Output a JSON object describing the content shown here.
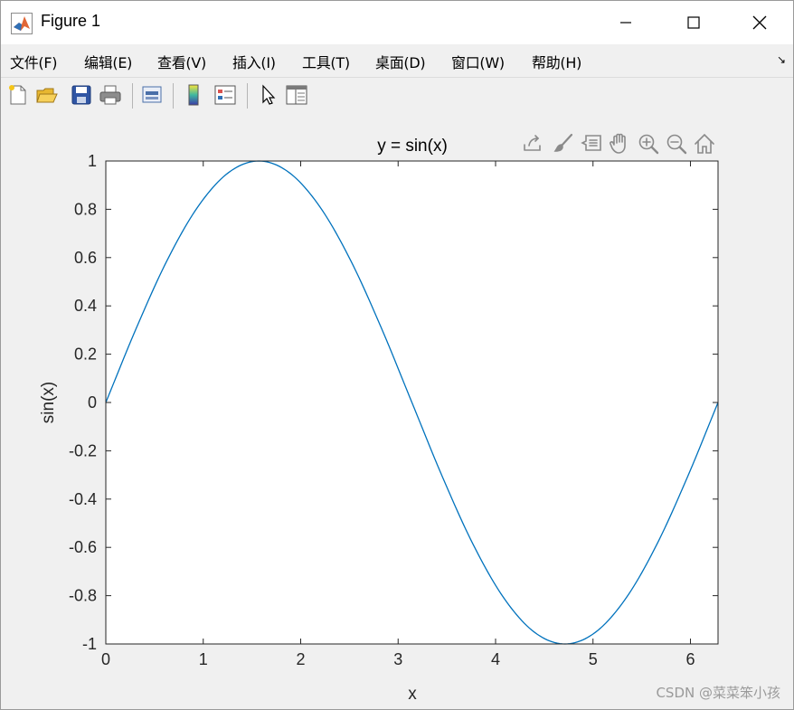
{
  "window": {
    "title": "Figure 1",
    "controls": {
      "minimize": "—",
      "maximize": "☐",
      "close": "✕"
    }
  },
  "menubar": {
    "items": [
      "文件(F)",
      "编辑(E)",
      "查看(V)",
      "插入(I)",
      "工具(T)",
      "桌面(D)",
      "窗口(W)",
      "帮助(H)"
    ],
    "corner": "↘"
  },
  "toolbar": {
    "buttons": [
      "new-figure-icon",
      "open-file-icon",
      "save-icon",
      "print-icon",
      "link-plot-icon",
      "colorbar-icon",
      "legend-icon",
      "edit-plot-pointer-icon",
      "property-inspector-icon"
    ]
  },
  "axes_toolbar": {
    "buttons": [
      "export-icon",
      "brush-icon",
      "data-tips-icon",
      "pan-hand-icon",
      "zoom-in-icon",
      "zoom-out-icon",
      "home-icon"
    ]
  },
  "chart_data": {
    "type": "line",
    "title": "y = sin(x)",
    "xlabel": "x",
    "ylabel": "sin(x)",
    "xlim": [
      0,
      6.2832
    ],
    "ylim": [
      -1,
      1
    ],
    "xticks": [
      0,
      1,
      2,
      3,
      4,
      5,
      6
    ],
    "xtick_labels": [
      "0",
      "1",
      "2",
      "3",
      "4",
      "5",
      "6"
    ],
    "yticks": [
      -1,
      -0.8,
      -0.6,
      -0.4,
      -0.2,
      0,
      0.2,
      0.4,
      0.6,
      0.8,
      1
    ],
    "ytick_labels": [
      "-1",
      "-0.8",
      "-0.6",
      "-0.4",
      "-0.2",
      "0",
      "0.2",
      "0.4",
      "0.6",
      "0.8",
      "1"
    ],
    "grid": false,
    "series": [
      {
        "color": "#0072bd",
        "x": [
          0,
          0.3142,
          0.6283,
          0.9425,
          1.2566,
          1.5708,
          1.885,
          2.1991,
          2.5133,
          2.8274,
          3.1416,
          3.4558,
          3.7699,
          4.0841,
          4.3982,
          4.7124,
          5.0265,
          5.3407,
          5.6549,
          5.969,
          6.2832
        ],
        "y": [
          0,
          0.309,
          0.5878,
          0.809,
          0.9511,
          1,
          0.9511,
          0.809,
          0.5878,
          0.309,
          0,
          -0.309,
          -0.5878,
          -0.809,
          -0.9511,
          -1,
          -0.9511,
          -0.809,
          -0.5878,
          -0.309,
          0
        ]
      }
    ]
  },
  "watermark": "CSDN @菜菜笨小孩"
}
